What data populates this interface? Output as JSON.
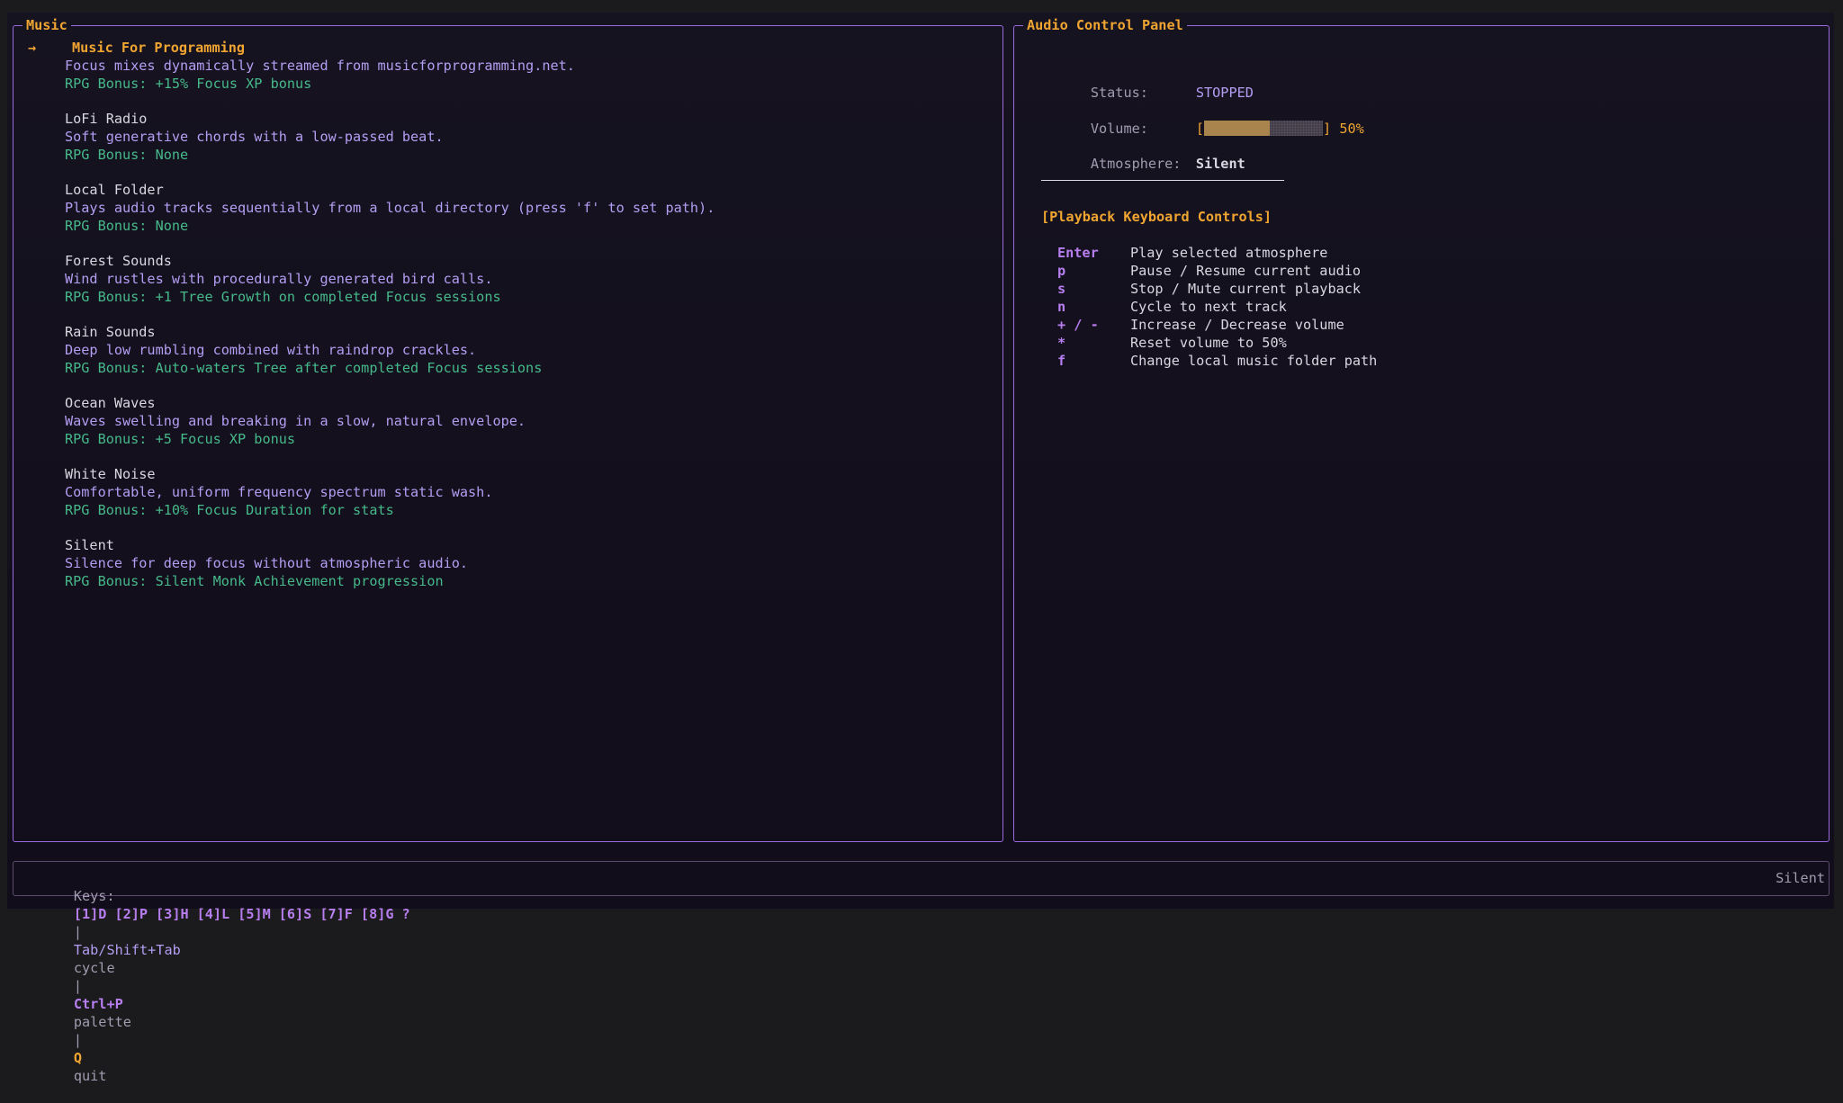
{
  "music_panel": {
    "title": "Music",
    "selected_arrow": "→",
    "items": [
      {
        "name": "Music For Programming",
        "description": "Focus mixes dynamically streamed from musicforprogramming.net.",
        "bonus": "RPG Bonus: +15% Focus XP bonus",
        "selected": true
      },
      {
        "name": "LoFi Radio",
        "description": "Soft generative chords with a low-passed beat.",
        "bonus": "RPG Bonus: None",
        "selected": false
      },
      {
        "name": "Local Folder",
        "description": "Plays audio tracks sequentially from a local directory (press 'f' to set path).",
        "bonus": "RPG Bonus: None",
        "selected": false
      },
      {
        "name": "Forest Sounds",
        "description": "Wind rustles with procedurally generated bird calls.",
        "bonus": "RPG Bonus: +1 Tree Growth on completed Focus sessions",
        "selected": false
      },
      {
        "name": "Rain Sounds",
        "description": "Deep low rumbling combined with raindrop crackles.",
        "bonus": "RPG Bonus: Auto-waters Tree after completed Focus sessions",
        "selected": false
      },
      {
        "name": "Ocean Waves",
        "description": "Waves swelling and breaking in a slow, natural envelope.",
        "bonus": "RPG Bonus: +5 Focus XP bonus",
        "selected": false
      },
      {
        "name": "White Noise",
        "description": "Comfortable, uniform frequency spectrum static wash.",
        "bonus": "RPG Bonus: +10% Focus Duration for stats",
        "selected": false
      },
      {
        "name": "Silent",
        "description": "Silence for deep focus without atmospheric audio.",
        "bonus": "RPG Bonus: Silent Monk Achievement progression",
        "selected": false
      }
    ]
  },
  "control_panel": {
    "title": "Audio Control Panel",
    "status_label": "Status:",
    "status_value": "STOPPED",
    "volume_label": "Volume:",
    "volume_open": "[",
    "volume_close": "]",
    "volume_text": "50%",
    "volume_fraction": 0.5,
    "atmosphere_label": "Atmosphere:",
    "atmosphere_value": "Silent",
    "controls_heading": "[Playback Keyboard Controls]",
    "controls": [
      {
        "key": "Enter",
        "action": "Play selected atmosphere"
      },
      {
        "key": "p",
        "action": "Pause / Resume current audio"
      },
      {
        "key": "s",
        "action": "Stop / Mute current playback"
      },
      {
        "key": "n",
        "action": "Cycle to next track"
      },
      {
        "key": "+ / -",
        "action": "Increase / Decrease volume"
      },
      {
        "key": "*",
        "action": "Reset volume to 50%"
      },
      {
        "key": "f",
        "action": "Change local music folder path"
      }
    ]
  },
  "status_bar": {
    "keys_label": "Keys:",
    "shortcuts": [
      "[1]D",
      "[2]P",
      "[3]H",
      "[4]L",
      "[5]M",
      "[6]S",
      "[7]F",
      "[8]G",
      "?"
    ],
    "sep": "|",
    "cycle_key": "Tab/Shift+Tab",
    "cycle_label": "cycle",
    "palette_key": "Ctrl+P",
    "palette_label": "palette",
    "quit_key": "Q",
    "quit_label": "quit",
    "right_text": "Silent"
  },
  "colors": {
    "accent_purple": "#9b6ae0",
    "title_orange": "#f0a531",
    "description_purple": "#b39ef2",
    "bonus_green": "#46b98a",
    "volume_fill": "#a9844c"
  }
}
